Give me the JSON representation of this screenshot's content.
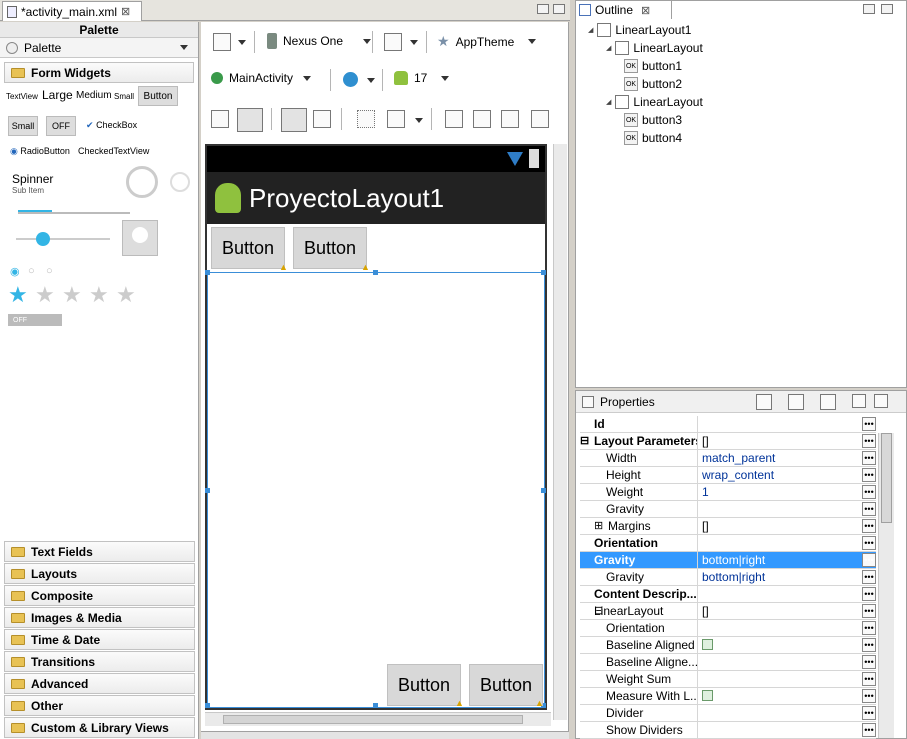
{
  "editor": {
    "tab_label": "*activity_main.xml",
    "tab_close": "⊠"
  },
  "palette": {
    "header": "Palette",
    "dropdown_label": "Palette",
    "form_widgets": "Form Widgets",
    "widgets": {
      "textview": "TextView",
      "large": "Large",
      "medium": "Medium",
      "small": "Small",
      "button": "Button",
      "small_btn": "Small",
      "off": "OFF",
      "checkbox": "CheckBox",
      "radiobutton": "RadioButton",
      "checkedtextview": "CheckedTextView",
      "spinner": "Spinner",
      "subitem": "Sub Item",
      "toggle_off": "OFF"
    },
    "categories": [
      "Text Fields",
      "Layouts",
      "Composite",
      "Images & Media",
      "Time & Date",
      "Transitions",
      "Advanced",
      "Other",
      "Custom & Library Views"
    ]
  },
  "toolbar": {
    "device": "Nexus One",
    "theme": "AppTheme",
    "activity": "MainActivity",
    "api": "17"
  },
  "device": {
    "app_title": "ProyectoLayout1",
    "top_buttons": [
      "Button",
      "Button"
    ],
    "bottom_buttons": [
      "Button",
      "Button"
    ]
  },
  "outline": {
    "tab_label": "Outline",
    "tree": [
      {
        "label": "LinearLayout1",
        "level": 0
      },
      {
        "label": "LinearLayout",
        "level": 1
      },
      {
        "label": "button1",
        "level": 2
      },
      {
        "label": "button2",
        "level": 2
      },
      {
        "label": "LinearLayout",
        "level": 1
      },
      {
        "label": "button3",
        "level": 2
      },
      {
        "label": "button4",
        "level": 2
      }
    ]
  },
  "properties": {
    "title": "Properties",
    "rows": [
      {
        "name": "Id",
        "value": "",
        "bold": true
      },
      {
        "name": "Layout Parameters",
        "value": "[]",
        "bold": true,
        "expander": "⊟"
      },
      {
        "name": "Width",
        "value": "match_parent"
      },
      {
        "name": "Height",
        "value": "wrap_content"
      },
      {
        "name": "Weight",
        "value": "1"
      },
      {
        "name": "Gravity",
        "value": ""
      },
      {
        "name": "Margins",
        "value": "[]",
        "expander": "⊞"
      },
      {
        "name": "Orientation",
        "value": "",
        "bold": true
      },
      {
        "name": "Gravity",
        "value": "bottom|right",
        "bold": true,
        "selected": true
      },
      {
        "name": "Gravity",
        "value": "bottom|right"
      },
      {
        "name": "Content Descrip...",
        "value": "",
        "bold": true
      },
      {
        "name": "LinearLayout",
        "value": "[]",
        "expander": "⊟",
        "plain_head": true
      },
      {
        "name": "Orientation",
        "value": ""
      },
      {
        "name": "Baseline Aligned",
        "value": "",
        "check": true
      },
      {
        "name": "Baseline Aligne...",
        "value": ""
      },
      {
        "name": "Weight Sum",
        "value": ""
      },
      {
        "name": "Measure With L...",
        "value": "",
        "check": true
      },
      {
        "name": "Divider",
        "value": ""
      },
      {
        "name": "Show Dividers",
        "value": ""
      }
    ]
  },
  "colors": {
    "selection": "#3399ff",
    "action_bar": "#222222",
    "accent": "#33b5e5"
  }
}
